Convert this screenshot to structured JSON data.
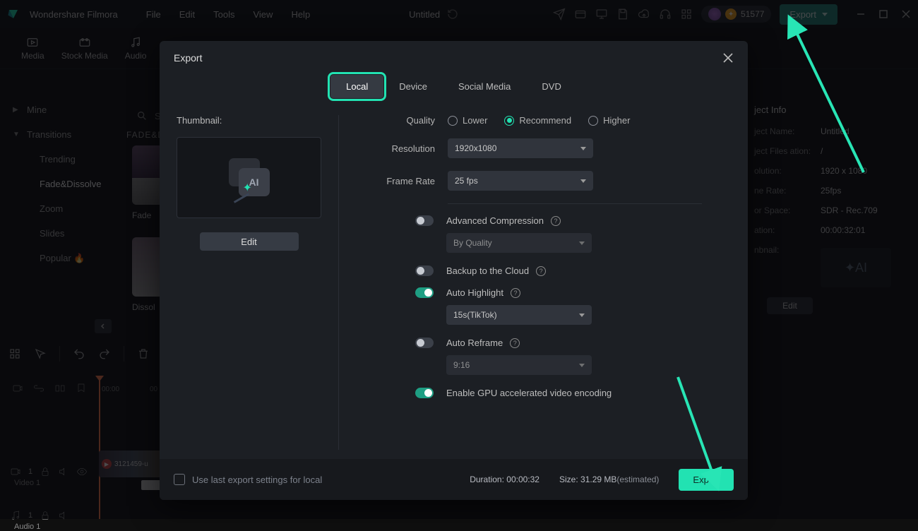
{
  "app_name": "Wondershare Filmora",
  "menus": [
    "File",
    "Edit",
    "Tools",
    "View",
    "Help"
  ],
  "project_title": "Untitled",
  "credits": "51577",
  "export_top_label": "Export",
  "tabs": {
    "media": "Media",
    "stock": "Stock Media",
    "audio": "Audio"
  },
  "sidebar": {
    "mine": "Mine",
    "transitions": "Transitions",
    "items": [
      "Trending",
      "Fade&Dissolve",
      "Zoom",
      "Slides",
      "Popular 🔥"
    ]
  },
  "content": {
    "category": "FADE&D",
    "thumbs": [
      "Fade",
      "Dissol"
    ]
  },
  "right_panel": {
    "title": "ject Info",
    "rows": [
      {
        "k": "ject Name:",
        "v": "Untitled"
      },
      {
        "k": "ject Files ation:",
        "v": "/"
      },
      {
        "k": "olution:",
        "v": "1920 x 1080"
      },
      {
        "k": "ne Rate:",
        "v": "25fps"
      },
      {
        "k": "or Space:",
        "v": "SDR - Rec.709"
      },
      {
        "k": "ation:",
        "v": "00:00:32:01"
      },
      {
        "k": "nbnail:",
        "v": ""
      }
    ],
    "edit": "Edit"
  },
  "ruler": [
    "00:00",
    "00"
  ],
  "tracks": {
    "v1_n": "1",
    "v1_label": "Video 1",
    "a1_n": "1",
    "a1_label": "Audio 1",
    "clip_name": "3121459-u"
  },
  "modal": {
    "title": "Export",
    "tabs": [
      "Local",
      "Device",
      "Social Media",
      "DVD"
    ],
    "thumb_label": "Thumbnail:",
    "edit_label": "Edit",
    "quality_label": "Quality",
    "quality_opts": [
      "Lower",
      "Recommend",
      "Higher"
    ],
    "resolution_label": "Resolution",
    "resolution_value": "1920x1080",
    "framerate_label": "Frame Rate",
    "framerate_value": "25 fps",
    "adv_comp": "Advanced Compression",
    "adv_comp_sel": "By Quality",
    "backup": "Backup to the Cloud",
    "auto_hi": "Auto Highlight",
    "auto_hi_sel": "15s(TikTok)",
    "auto_reframe": "Auto Reframe",
    "auto_reframe_sel": "9:16",
    "gpu": "Enable GPU accelerated video encoding",
    "use_last": "Use last export settings for local",
    "duration_k": "Duration:",
    "duration_v": "00:00:32",
    "size_k": "Size:",
    "size_v": "31.29 MB",
    "size_est": "(estimated)",
    "export_btn": "Export"
  }
}
